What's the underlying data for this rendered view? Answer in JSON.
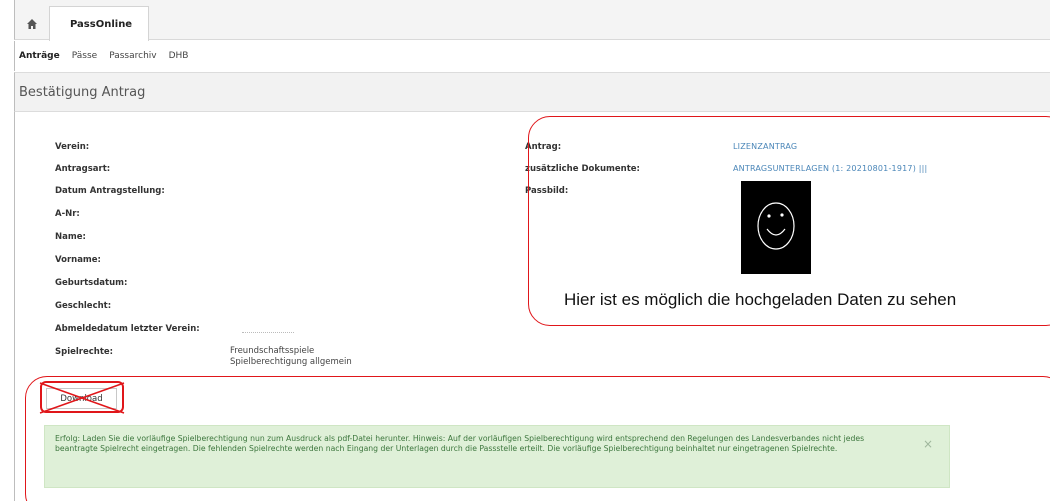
{
  "tabs": {
    "home_icon": "home-icon",
    "app_tab": "PassOnline"
  },
  "subnav": {
    "items": [
      "Anträge",
      "Pässe",
      "Passarchiv",
      "DHB"
    ]
  },
  "page_title": "Bestätigung Antrag",
  "left_fields": [
    {
      "label": "Verein:",
      "value": ""
    },
    {
      "label": "Antragsart:",
      "value": ""
    },
    {
      "label": "Datum Antragstellung:",
      "value": ""
    },
    {
      "label": "A-Nr:",
      "value": ""
    },
    {
      "label": "Name:",
      "value": ""
    },
    {
      "label": "Vorname:",
      "value": ""
    },
    {
      "label": "Geburtsdatum:",
      "value": ""
    },
    {
      "label": "Geschlecht:",
      "value": ""
    },
    {
      "label": "Abmeldedatum letzter Verein:",
      "value": ""
    },
    {
      "label": "Spielrechte:",
      "value": [
        "Freundschaftsspiele",
        "Spielberechtigung allgemein"
      ]
    }
  ],
  "right_fields": {
    "antrag_label": "Antrag:",
    "antrag_value": "LIZENZANTRAG",
    "docs_label": "zusätzliche Dokumente:",
    "docs_value": "ANTRAGSUNTERLAGEN (1: 20210801-1917) |||",
    "photo_label": "Passbild:"
  },
  "annotation": "Hier ist es möglich die hochgeladen Daten zu sehen",
  "download_label": "Download",
  "alert": {
    "text": "Erfolg: Laden Sie die vorläufige Spielberechtigung nun zum Ausdruck als pdf-Datei herunter. Hinweis: Auf der vorläufigen Spielberechtigung wird entsprechend den Regelungen des Landesverbandes nicht jedes beantragte Spielrecht eingetragen. Die fehlenden Spielrechte werden nach Eingang der Unterlagen durch die Passstelle erteilt. Die vorläufige Spielberechtigung beinhaltet nur eingetragenen Spielrechte.",
    "close": "×"
  },
  "colors": {
    "link": "#4a86b8",
    "annotation_red": "#e0161a",
    "alert_bg": "#dff0d8",
    "alert_text": "#3c763d"
  }
}
